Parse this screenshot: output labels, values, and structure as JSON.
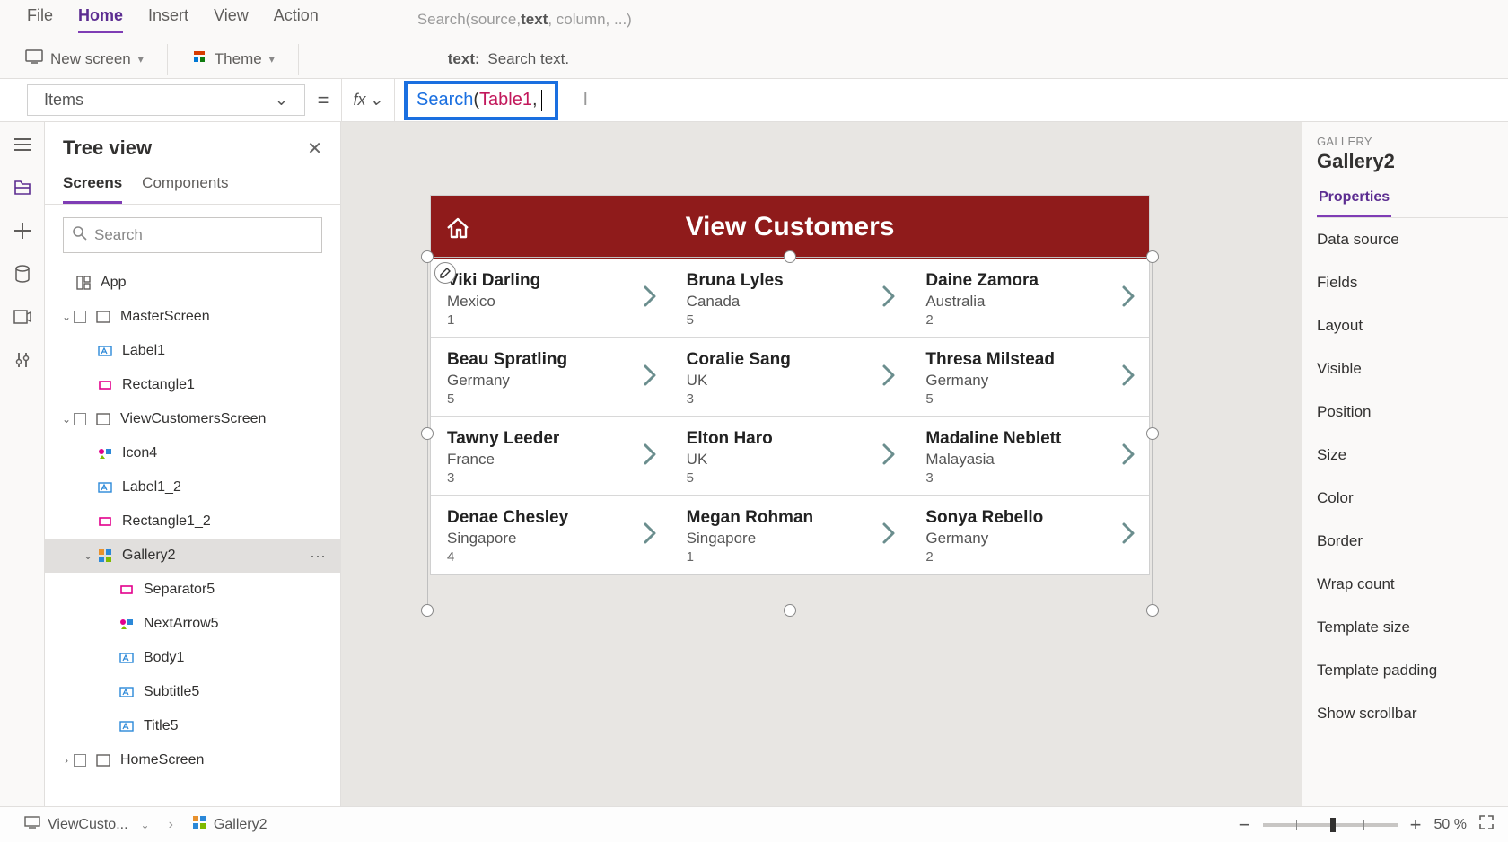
{
  "menu": {
    "tabs": [
      "File",
      "Home",
      "Insert",
      "View",
      "Action"
    ],
    "active": "Home"
  },
  "intellisense_signature_pre": "Search(source, ",
  "intellisense_signature_bold": "text",
  "intellisense_signature_post": ", column, ...)",
  "ribbon": {
    "newscreen": "New screen",
    "theme": "Theme",
    "tip_label": "text:",
    "tip_text": "Search text."
  },
  "property_selector": "Items",
  "formula": {
    "keyword": "Search",
    "open": "(",
    "arg1": "Table1",
    "comma": ", "
  },
  "tree": {
    "title": "Tree view",
    "tabs": [
      "Screens",
      "Components"
    ],
    "active_tab": "Screens",
    "search_placeholder": "Search",
    "nodes": [
      {
        "depth": 0,
        "chev": "",
        "icon": "app",
        "label": "App"
      },
      {
        "depth": 0,
        "chev": "v",
        "icon": "screen",
        "label": "MasterScreen",
        "checkbox": true
      },
      {
        "depth": 1,
        "chev": "",
        "icon": "label",
        "label": "Label1"
      },
      {
        "depth": 1,
        "chev": "",
        "icon": "rect",
        "label": "Rectangle1"
      },
      {
        "depth": 0,
        "chev": "v",
        "icon": "screen",
        "label": "ViewCustomersScreen",
        "checkbox": true
      },
      {
        "depth": 1,
        "chev": "",
        "icon": "icons",
        "label": "Icon4"
      },
      {
        "depth": 1,
        "chev": "",
        "icon": "label",
        "label": "Label1_2"
      },
      {
        "depth": 1,
        "chev": "",
        "icon": "rect",
        "label": "Rectangle1_2"
      },
      {
        "depth": 1,
        "chev": "v",
        "icon": "gallery",
        "label": "Gallery2",
        "selected": true,
        "more": true
      },
      {
        "depth": 2,
        "chev": "",
        "icon": "rect",
        "label": "Separator5"
      },
      {
        "depth": 2,
        "chev": "",
        "icon": "icons",
        "label": "NextArrow5"
      },
      {
        "depth": 2,
        "chev": "",
        "icon": "label",
        "label": "Body1"
      },
      {
        "depth": 2,
        "chev": "",
        "icon": "label",
        "label": "Subtitle5"
      },
      {
        "depth": 2,
        "chev": "",
        "icon": "label",
        "label": "Title5"
      },
      {
        "depth": 0,
        "chev": ">",
        "icon": "screen",
        "label": "HomeScreen",
        "checkbox": true
      }
    ]
  },
  "canvas_title": "View Customers",
  "gallery_rows": [
    [
      {
        "name": "Viki  Darling",
        "sub": "Mexico",
        "num": "1"
      },
      {
        "name": "Bruna  Lyles",
        "sub": "Canada",
        "num": "5"
      },
      {
        "name": "Daine  Zamora",
        "sub": "Australia",
        "num": "2"
      }
    ],
    [
      {
        "name": "Beau  Spratling",
        "sub": "Germany",
        "num": "5"
      },
      {
        "name": "Coralie  Sang",
        "sub": "UK",
        "num": "3"
      },
      {
        "name": "Thresa  Milstead",
        "sub": "Germany",
        "num": "5"
      }
    ],
    [
      {
        "name": "Tawny  Leeder",
        "sub": "France",
        "num": "3"
      },
      {
        "name": "Elton  Haro",
        "sub": "UK",
        "num": "5"
      },
      {
        "name": "Madaline  Neblett",
        "sub": "Malayasia",
        "num": "3"
      }
    ],
    [
      {
        "name": "Denae  Chesley",
        "sub": "Singapore",
        "num": "4"
      },
      {
        "name": "Megan  Rohman",
        "sub": "Singapore",
        "num": "1"
      },
      {
        "name": "Sonya  Rebello",
        "sub": "Germany",
        "num": "2"
      }
    ]
  ],
  "props": {
    "category": "GALLERY",
    "name": "Gallery2",
    "tab": "Properties",
    "rows": [
      "Data source",
      "Fields",
      "Layout",
      "Visible",
      "Position",
      "Size",
      "Color",
      "Border",
      "Wrap count",
      "Template size",
      "Template padding",
      "Show scrollbar"
    ]
  },
  "breadcrumb": {
    "screen": "ViewCusto...",
    "control": "Gallery2"
  },
  "zoom": {
    "percent": "50",
    "unit": "%"
  }
}
